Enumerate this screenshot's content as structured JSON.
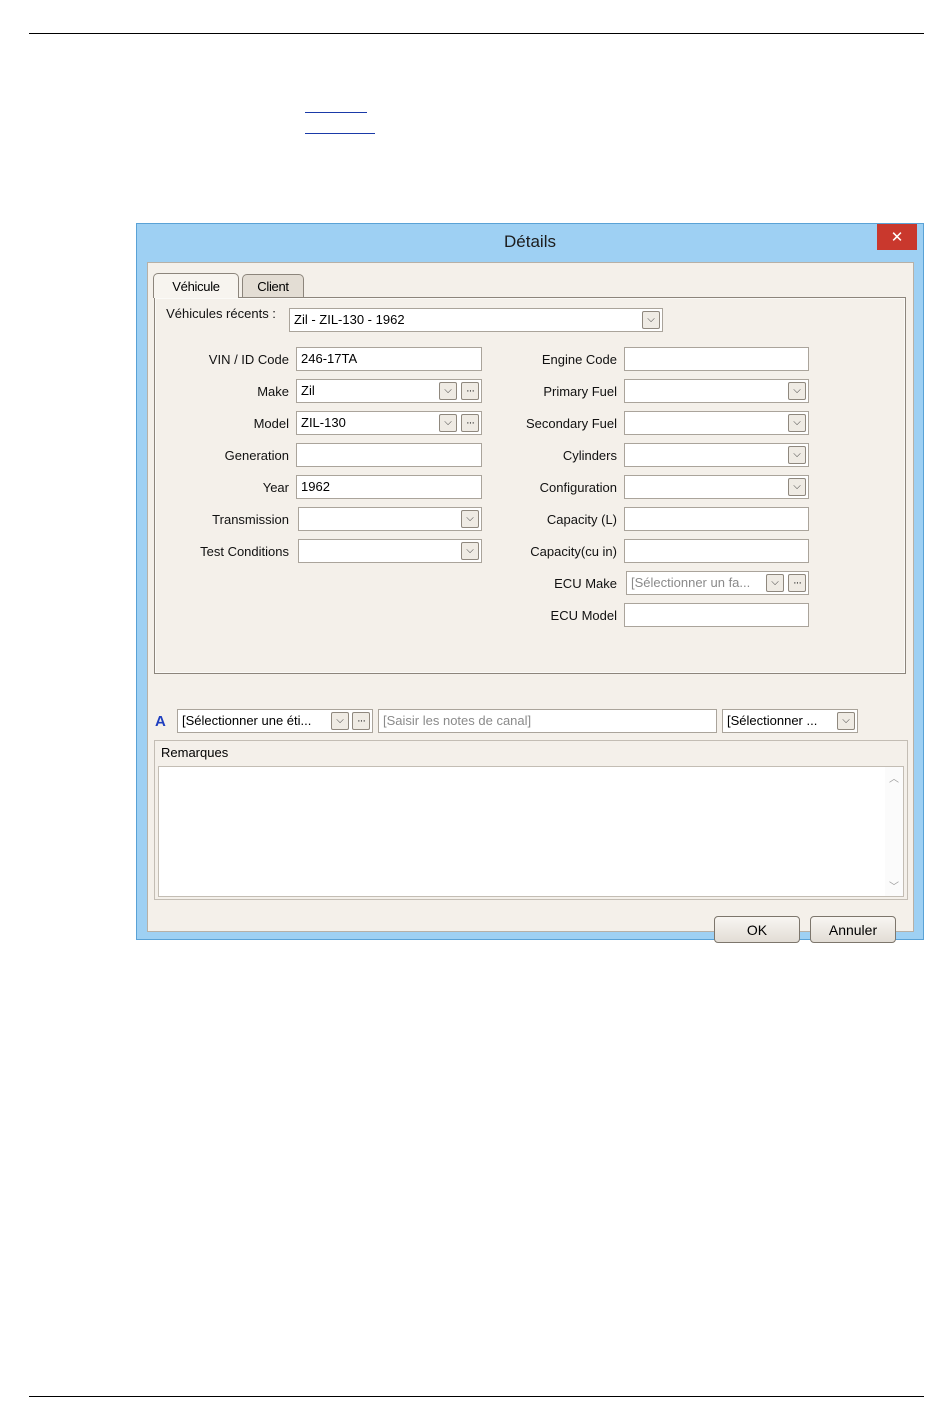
{
  "dialog": {
    "title": "Détails",
    "close_glyph": "✕",
    "tabs": [
      {
        "label": "Véhicule",
        "active": true
      },
      {
        "label": "Client",
        "active": false
      }
    ],
    "recent": {
      "label": "Véhicules récents :",
      "value": "Zil - ZIL-130 - 1962"
    },
    "left_fields": {
      "vin": {
        "label": "VIN / ID Code",
        "value": "246-17TA"
      },
      "make": {
        "label": "Make",
        "value": "Zil"
      },
      "model": {
        "label": "Model",
        "value": "ZIL-130"
      },
      "generation": {
        "label": "Generation",
        "value": ""
      },
      "year": {
        "label": "Year",
        "value": "1962"
      },
      "transmission": {
        "label": "Transmission",
        "value": ""
      },
      "test_conditions": {
        "label": "Test Conditions",
        "value": ""
      }
    },
    "right_fields": {
      "engine_code": {
        "label": "Engine Code",
        "value": ""
      },
      "primary_fuel": {
        "label": "Primary Fuel",
        "value": ""
      },
      "secondary_fuel": {
        "label": "Secondary Fuel",
        "value": ""
      },
      "cylinders": {
        "label": "Cylinders",
        "value": ""
      },
      "configuration": {
        "label": "Configuration",
        "value": ""
      },
      "capacity_l": {
        "label": "Capacity (L)",
        "value": ""
      },
      "capacity_cuin": {
        "label": "Capacity(cu in)",
        "value": ""
      },
      "ecu_make": {
        "label": "ECU Make",
        "placeholder": "[Sélectionner un fa..."
      },
      "ecu_model": {
        "label": "ECU Model",
        "value": ""
      }
    },
    "notes_bar": {
      "icon_letter": "A",
      "label_select": "[Sélectionner une éti...",
      "channel_notes_placeholder": "[Saisir les notes de canal]",
      "right_select": "[Sélectionner ..."
    },
    "remarks": {
      "label": "Remarques",
      "text": ""
    },
    "buttons": {
      "ok": "OK",
      "cancel": "Annuler"
    }
  }
}
